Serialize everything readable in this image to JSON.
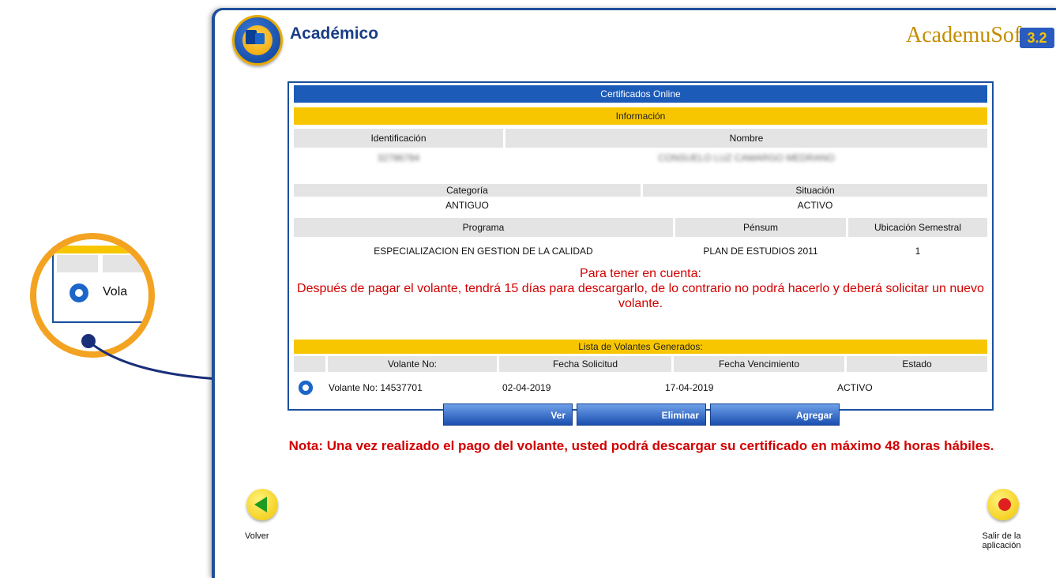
{
  "header": {
    "title": "Académico",
    "brand": "AcademuSoft",
    "brand_version": "3.2"
  },
  "panel": {
    "title": "Certificados Online",
    "info_title": "Información",
    "labels": {
      "identificacion": "Identificación",
      "nombre": "Nombre",
      "categoria": "Categoría",
      "situacion": "Situación",
      "programa": "Programa",
      "pensum": "Pénsum",
      "ubicacion": "Ubicación Semestral"
    },
    "values": {
      "identificacion": "32786784",
      "nombre": "CONSUELO LUZ CAMARGO MEDRANO",
      "categoria": "ANTIGUO",
      "situacion": "ACTIVO",
      "programa": "ESPECIALIZACION EN GESTION DE LA CALIDAD",
      "pensum": "PLAN DE ESTUDIOS 2011",
      "ubicacion": "1"
    },
    "notice_title": "Para tener en cuenta:",
    "notice_body": "Después de pagar el volante, tendrá 15 días para descargarlo, de lo contrario no podrá hacerlo y deberá solicitar un nuevo volante.",
    "list_title": "Lista de Volantes Generados:",
    "columns": [
      "Volante No:",
      "Fecha Solicitud",
      "Fecha Vencimiento",
      "Estado"
    ],
    "rows": [
      {
        "volante": "Volante No: 14537701",
        "fecha_solicitud": "02-04-2019",
        "fecha_vencimiento": "17-04-2019",
        "estado": "ACTIVO"
      }
    ]
  },
  "buttons": {
    "ver": "Ver",
    "eliminar": "Eliminar",
    "agregar": "Agregar"
  },
  "note": "Nota: Una vez realizado el pago del volante, usted podrá descargar su certificado en máximo 48 horas hábiles.",
  "nav": {
    "back_label": "Volver",
    "exit_label": "Salir de la aplicación"
  },
  "zoom": {
    "text": "Vola"
  }
}
